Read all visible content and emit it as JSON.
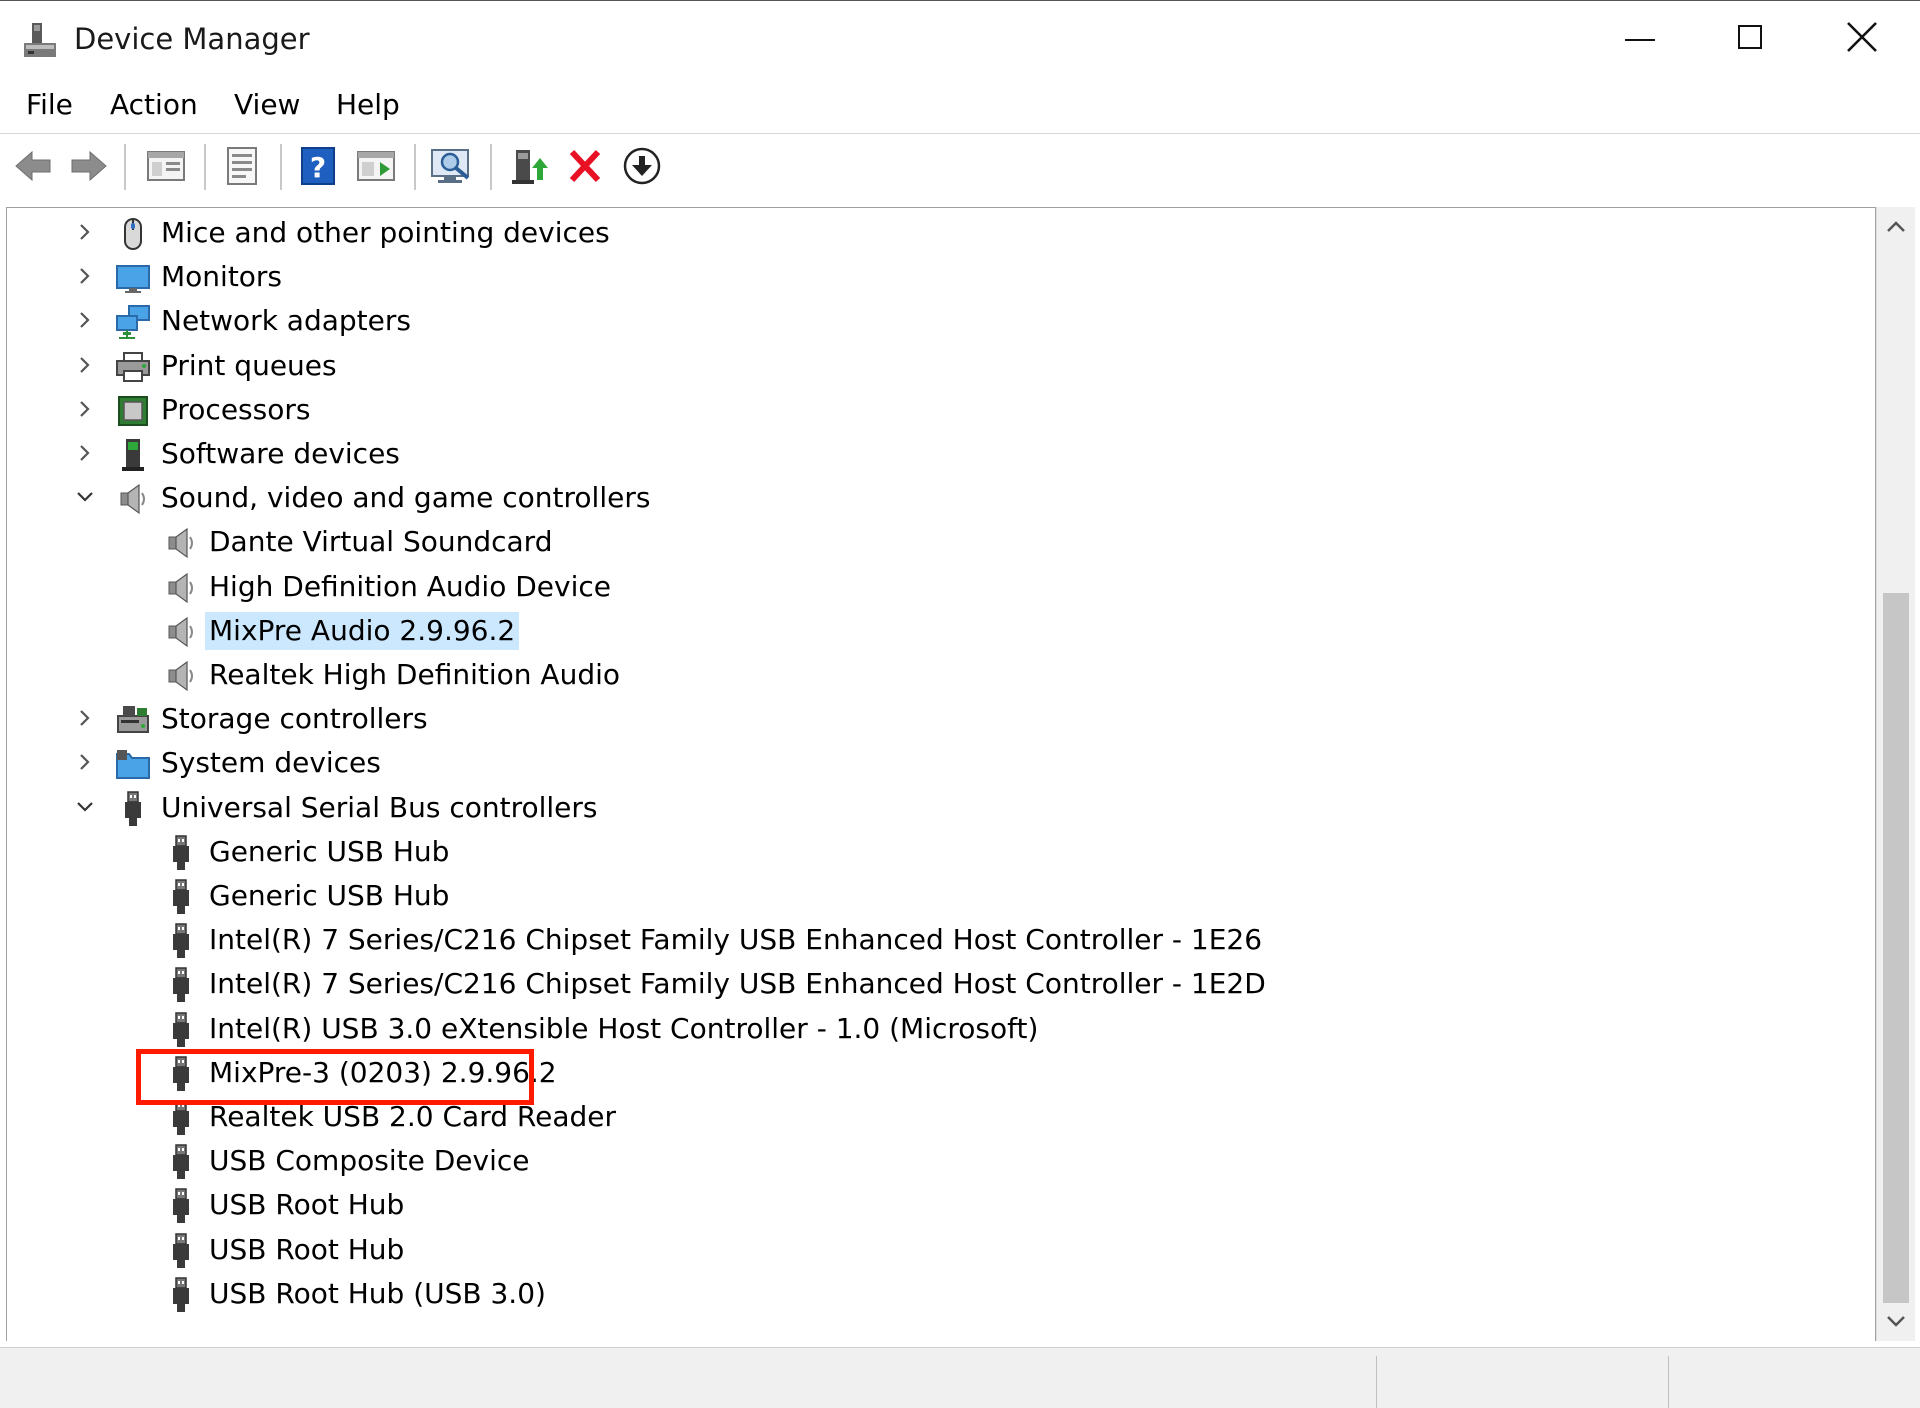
{
  "window": {
    "title": "Device Manager",
    "controls": {
      "minimize": "minimize-icon",
      "maximize": "maximize-icon",
      "close": "close-icon"
    }
  },
  "menu": {
    "items": [
      "File",
      "Action",
      "View",
      "Help"
    ]
  },
  "toolbar": {
    "buttons": [
      "back-icon",
      "forward-icon",
      "show-hide-console-tree-icon",
      "properties-icon",
      "help-icon",
      "action-pane-icon",
      "scan-hardware-icon",
      "update-driver-icon",
      "uninstall-device-icon",
      "disable-device-icon"
    ]
  },
  "tree": {
    "items": [
      {
        "label": "Mice and other pointing devices",
        "level": 0,
        "expanded": false,
        "icon": "mouse-icon"
      },
      {
        "label": "Monitors",
        "level": 0,
        "expanded": false,
        "icon": "monitor-icon"
      },
      {
        "label": "Network adapters",
        "level": 0,
        "expanded": false,
        "icon": "network-icon"
      },
      {
        "label": "Print queues",
        "level": 0,
        "expanded": false,
        "icon": "printer-icon"
      },
      {
        "label": "Processors",
        "level": 0,
        "expanded": false,
        "icon": "processor-icon"
      },
      {
        "label": "Software devices",
        "level": 0,
        "expanded": false,
        "icon": "software-device-icon"
      },
      {
        "label": "Sound, video and game controllers",
        "level": 0,
        "expanded": true,
        "icon": "speaker-icon"
      },
      {
        "label": "Dante Virtual Soundcard",
        "level": 1,
        "icon": "speaker-icon"
      },
      {
        "label": "High Definition Audio Device",
        "level": 1,
        "icon": "speaker-icon"
      },
      {
        "label": "MixPre Audio 2.9.96.2",
        "level": 1,
        "icon": "speaker-icon",
        "selected": true
      },
      {
        "label": "Realtek High Definition Audio",
        "level": 1,
        "icon": "speaker-icon"
      },
      {
        "label": "Storage controllers",
        "level": 0,
        "expanded": false,
        "icon": "storage-icon"
      },
      {
        "label": "System devices",
        "level": 0,
        "expanded": false,
        "icon": "system-folder-icon"
      },
      {
        "label": "Universal Serial Bus controllers",
        "level": 0,
        "expanded": true,
        "icon": "usb-icon"
      },
      {
        "label": "Generic USB Hub",
        "level": 1,
        "icon": "usb-icon"
      },
      {
        "label": "Generic USB Hub",
        "level": 1,
        "icon": "usb-icon"
      },
      {
        "label": "Intel(R) 7 Series/C216 Chipset Family USB Enhanced Host Controller - 1E26",
        "level": 1,
        "icon": "usb-icon"
      },
      {
        "label": "Intel(R) 7 Series/C216 Chipset Family USB Enhanced Host Controller - 1E2D",
        "level": 1,
        "icon": "usb-icon"
      },
      {
        "label": "Intel(R) USB 3.0 eXtensible Host Controller - 1.0 (Microsoft)",
        "level": 1,
        "icon": "usb-icon"
      },
      {
        "label": "MixPre-3 (0203) 2.9.96.2",
        "level": 1,
        "icon": "usb-icon",
        "highlighted": true
      },
      {
        "label": "Realtek USB 2.0 Card Reader",
        "level": 1,
        "icon": "usb-icon"
      },
      {
        "label": "USB Composite Device",
        "level": 1,
        "icon": "usb-icon"
      },
      {
        "label": "USB Root Hub",
        "level": 1,
        "icon": "usb-icon"
      },
      {
        "label": "USB Root Hub",
        "level": 1,
        "icon": "usb-icon"
      },
      {
        "label": "USB Root Hub (USB 3.0)",
        "level": 1,
        "icon": "usb-icon"
      }
    ]
  },
  "colors": {
    "selection": "#cce8ff",
    "highlight_box": "#ff1a00",
    "uninstall_x": "#e81123"
  }
}
